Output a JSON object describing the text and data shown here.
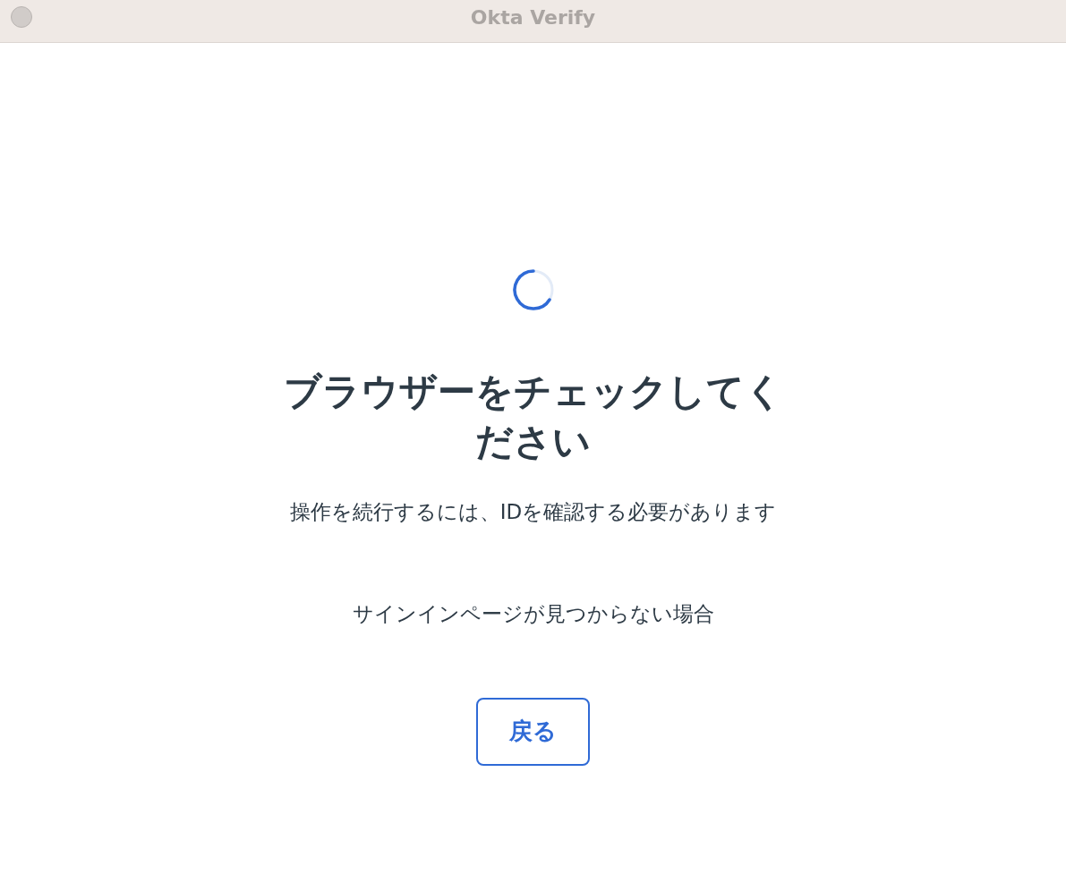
{
  "window": {
    "title": "Okta Verify"
  },
  "heading": "ブラウザーをチェックしてください",
  "message": "操作を続行するには、IDを確認する必要があります",
  "help_text": "サインインページが見つからない場合",
  "back_button": "戻る"
}
